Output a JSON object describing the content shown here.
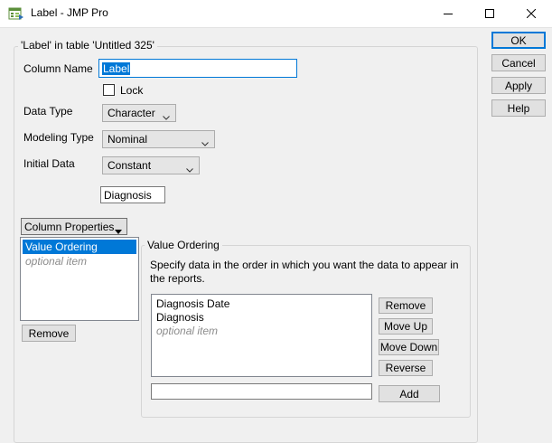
{
  "window": {
    "title": "Label - JMP Pro"
  },
  "colors": {
    "accent": "#0078d7",
    "selection": "#0078d7",
    "client_bg": "#f0f0f0"
  },
  "icons": {
    "app": "jmp-app-icon",
    "minimize": "minimize-icon",
    "maximize": "maximize-icon",
    "close": "close-icon",
    "dropdown": "chevron-down-icon"
  },
  "side_buttons": {
    "ok": "OK",
    "cancel": "Cancel",
    "apply": "Apply",
    "help": "Help"
  },
  "group": {
    "legend": "'Label' in table 'Untitled 325'"
  },
  "column_name": {
    "label": "Column Name",
    "value": "Label"
  },
  "lock": {
    "label": "Lock",
    "checked": false
  },
  "data_type": {
    "label": "Data Type",
    "value": "Character"
  },
  "modeling_type": {
    "label": "Modeling Type",
    "value": "Nominal"
  },
  "initial_data": {
    "label": "Initial Data",
    "value": "Constant",
    "constant_value": "Diagnosis"
  },
  "column_properties": {
    "menu_label": "Column Properties",
    "items": [
      "Value Ordering"
    ],
    "optional_item": "optional item",
    "remove_label": "Remove"
  },
  "value_ordering": {
    "legend": "Value Ordering",
    "description": "Specify data in the order in which you want the data to appear in the reports.",
    "values": [
      "Diagnosis Date",
      "Diagnosis"
    ],
    "optional_item": "optional item",
    "buttons": {
      "remove": "Remove",
      "move_up": "Move Up",
      "move_down": "Move Down",
      "reverse": "Reverse",
      "add": "Add"
    },
    "add_value": ""
  }
}
